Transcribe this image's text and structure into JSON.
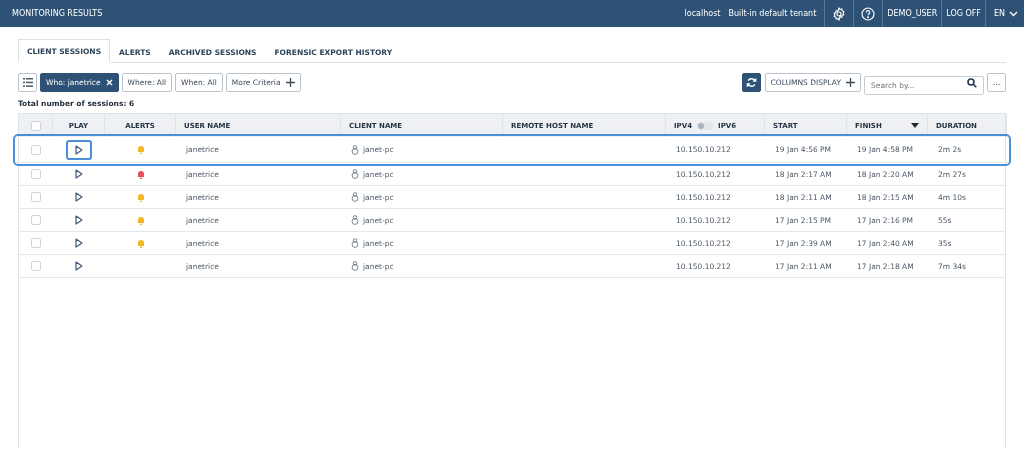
{
  "header": {
    "title": "MONITORING RESULTS",
    "host": "localhost",
    "tenant": "Built-in default tenant",
    "user": "DEMO_USER",
    "logoff": "LOG OFF",
    "language": "EN"
  },
  "tabs": [
    {
      "label": "CLIENT SESSIONS",
      "selected": true
    },
    {
      "label": "ALERTS",
      "selected": false
    },
    {
      "label": "ARCHIVED SESSIONS",
      "selected": false
    },
    {
      "label": "FORENSIC EXPORT HISTORY",
      "selected": false
    }
  ],
  "filters": [
    {
      "label": "Who: janetrice",
      "active": true
    },
    {
      "label": "Where: All",
      "active": false
    },
    {
      "label": "When: All",
      "active": false
    },
    {
      "label": "More Criteria",
      "active": false
    }
  ],
  "columns_button": "COLUMNS DISPLAY",
  "search": {
    "placeholder": "Search by..."
  },
  "more_button": "...",
  "total": "Total number of sessions: 6",
  "columns": [
    {
      "kind": "checkbox",
      "checked": false
    },
    {
      "kind": "text",
      "label": "PLAY"
    },
    {
      "kind": "text",
      "label": "ALERTS"
    },
    {
      "kind": "text",
      "label": "USER NAME"
    },
    {
      "kind": "text",
      "label": "CLIENT NAME"
    },
    {
      "kind": "text",
      "label": "REMOTE HOST NAME"
    },
    {
      "kind": "toggle",
      "label": "IPV4",
      "label_on": "IPV6",
      "on": false
    },
    {
      "kind": "text",
      "label": "START"
    },
    {
      "kind": "sorted",
      "label": "FINISH"
    },
    {
      "kind": "text",
      "label": "DURATION"
    }
  ],
  "rows": [
    {
      "selected": true,
      "checked": false,
      "alert": {
        "color": "#f2b824"
      },
      "user": "janetrice",
      "client": "janet-pc",
      "ip": "10.150.10.212",
      "start": "19 Jan 4:56 PM",
      "finish": "19 Jan 4:58 PM",
      "duration": "2m 2s"
    },
    {
      "selected": false,
      "checked": false,
      "alert": {
        "color": "#e8505b"
      },
      "user": "janetrice",
      "client": "janet-pc",
      "ip": "10.150.10.212",
      "start": "18 Jan 2:17 AM",
      "finish": "18 Jan 2:20 AM",
      "duration": "2m 27s"
    },
    {
      "selected": false,
      "checked": false,
      "alert": {
        "color": "#f2b824"
      },
      "user": "janetrice",
      "client": "janet-pc",
      "ip": "10.150.10.212",
      "start": "18 Jan 2:11 AM",
      "finish": "18 Jan 2:15 AM",
      "duration": "4m 10s"
    },
    {
      "selected": false,
      "checked": false,
      "alert": {
        "color": "#f2b824"
      },
      "user": "janetrice",
      "client": "janet-pc",
      "ip": "10.150.10.212",
      "start": "17 Jan 2:15 PM",
      "finish": "17 Jan 2:16 PM",
      "duration": "55s"
    },
    {
      "selected": false,
      "checked": false,
      "alert": {
        "color": "#f2b824"
      },
      "user": "janetrice",
      "client": "janet-pc",
      "ip": "10.150.10.212",
      "start": "17 Jan 2:39 AM",
      "finish": "17 Jan 2:40 AM",
      "duration": "35s"
    },
    {
      "selected": false,
      "checked": false,
      "user": "janetrice",
      "client": "janet-pc",
      "ip": "10.150.10.212",
      "start": "17 Jan 2:11 AM",
      "finish": "17 Jan 2:18 AM",
      "duration": "7m 34s"
    }
  ]
}
